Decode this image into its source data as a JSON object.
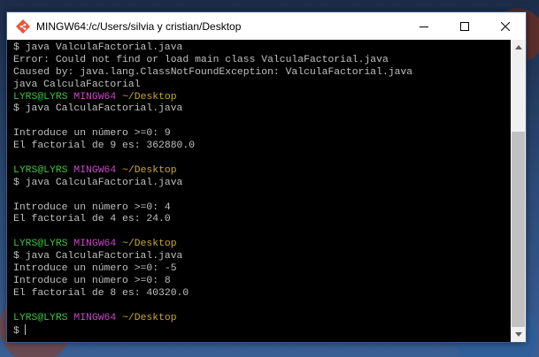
{
  "window": {
    "title": "MINGW64:/c/Users/silvia y cristian/Desktop"
  },
  "terminal": {
    "lines": [
      [
        {
          "text": "$ java ValculaFactorial.java",
          "color": "default"
        }
      ],
      [
        {
          "text": "Error: Could not find or load main class ValculaFactorial.java",
          "color": "default"
        }
      ],
      [
        {
          "text": "Caused by: java.lang.ClassNotFoundException: ValculaFactorial.java",
          "color": "default"
        }
      ],
      [
        {
          "text": "java CalculaFactorial",
          "color": "default"
        }
      ],
      [
        {
          "text": "LYRS@LYRS",
          "color": "green"
        },
        {
          "text": " ",
          "color": "default"
        },
        {
          "text": "MINGW64",
          "color": "magenta"
        },
        {
          "text": " ",
          "color": "default"
        },
        {
          "text": "~/Desktop",
          "color": "yellow"
        }
      ],
      [
        {
          "text": "$ java CalculaFactorial.java",
          "color": "default"
        }
      ],
      [
        {
          "text": "",
          "color": "default"
        }
      ],
      [
        {
          "text": "Introduce un número >=0: 9",
          "color": "default"
        }
      ],
      [
        {
          "text": "El factorial de 9 es: 362880.0",
          "color": "default"
        }
      ],
      [
        {
          "text": "",
          "color": "default"
        }
      ],
      [
        {
          "text": "LYRS@LYRS",
          "color": "green"
        },
        {
          "text": " ",
          "color": "default"
        },
        {
          "text": "MINGW64",
          "color": "magenta"
        },
        {
          "text": " ",
          "color": "default"
        },
        {
          "text": "~/Desktop",
          "color": "yellow"
        }
      ],
      [
        {
          "text": "$ java CalculaFactorial.java",
          "color": "default"
        }
      ],
      [
        {
          "text": "",
          "color": "default"
        }
      ],
      [
        {
          "text": "Introduce un número >=0: 4",
          "color": "default"
        }
      ],
      [
        {
          "text": "El factorial de 4 es: 24.0",
          "color": "default"
        }
      ],
      [
        {
          "text": "",
          "color": "default"
        }
      ],
      [
        {
          "text": "LYRS@LYRS",
          "color": "green"
        },
        {
          "text": " ",
          "color": "default"
        },
        {
          "text": "MINGW64",
          "color": "magenta"
        },
        {
          "text": " ",
          "color": "default"
        },
        {
          "text": "~/Desktop",
          "color": "yellow"
        }
      ],
      [
        {
          "text": "$ java CalculaFactorial.java",
          "color": "default"
        }
      ],
      [
        {
          "text": "Introduce un número >=0: -5",
          "color": "default"
        }
      ],
      [
        {
          "text": "Introduce un número >=0: 8",
          "color": "default"
        }
      ],
      [
        {
          "text": "El factorial de 8 es: 40320.0",
          "color": "default"
        }
      ],
      [
        {
          "text": "",
          "color": "default"
        }
      ],
      [
        {
          "text": "LYRS@LYRS",
          "color": "green"
        },
        {
          "text": " ",
          "color": "default"
        },
        {
          "text": "MINGW64",
          "color": "magenta"
        },
        {
          "text": " ",
          "color": "default"
        },
        {
          "text": "~/Desktop",
          "color": "yellow"
        }
      ]
    ],
    "prompt_symbol": "$"
  },
  "colors": {
    "default": "#c0c0c0",
    "green": "#3cc33c",
    "magenta": "#c847c8",
    "yellow": "#c9a82e"
  },
  "icons": {
    "app": "git-bash-icon",
    "minimize": "minimize-icon",
    "maximize": "maximize-icon",
    "close": "close-icon",
    "scroll_up": "scroll-up-arrow-icon",
    "scroll_down": "scroll-down-arrow-icon"
  }
}
